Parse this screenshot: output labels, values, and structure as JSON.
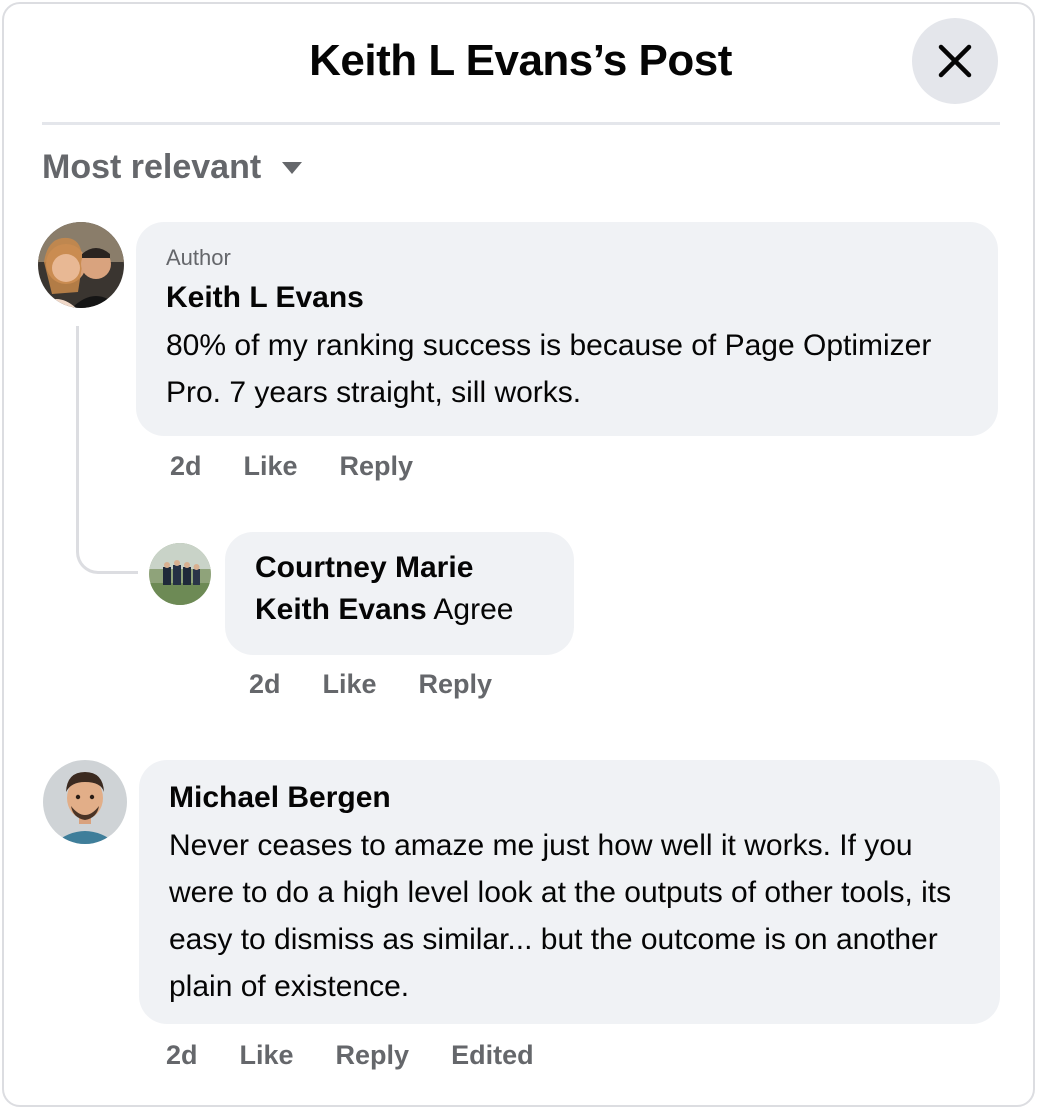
{
  "dialog": {
    "title": "Keith L Evans’s Post",
    "close_icon": "close-icon"
  },
  "sort": {
    "label": "Most relevant",
    "icon": "caret-down-icon"
  },
  "comments": [
    {
      "badge": "Author",
      "author": "Keith L Evans",
      "text": "80% of my ranking success is because of Page Optimizer Pro. 7 years straight, sill works.",
      "actions": {
        "time": "2d",
        "like": "Like",
        "reply": "Reply"
      }
    },
    {
      "author": "Courtney Marie",
      "mention": "Keith Evans",
      "text": "Agree",
      "actions": {
        "time": "2d",
        "like": "Like",
        "reply": "Reply"
      }
    },
    {
      "author": "Michael Bergen",
      "text": "Never ceases to amaze me just how well it works. If you were to do a high level look at the outputs of other tools, its easy to dismiss as similar... but the outcome is on another plain of existence.",
      "actions": {
        "time": "2d",
        "like": "Like",
        "reply": "Reply",
        "edited": "Edited"
      }
    }
  ]
}
